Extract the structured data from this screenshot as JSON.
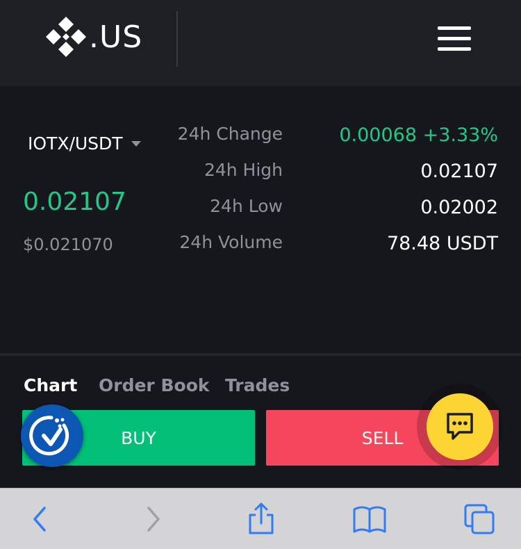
{
  "header": {
    "logo_text": ".US",
    "menu_icon": "hamburger-menu-icon"
  },
  "ticker": {
    "pair": "IOTX/USDT",
    "last_price": "0.02107",
    "usd_price": "$0.021070",
    "stats": [
      {
        "label": "24h Change",
        "value": "0.00068 +3.33%"
      },
      {
        "label": "24h High",
        "value": "0.02107"
      },
      {
        "label": "24h Low",
        "value": "0.02002"
      },
      {
        "label": "24h Volume",
        "value": "78.48 USDT"
      }
    ]
  },
  "tabs": [
    "Chart",
    "Order Book",
    "Trades"
  ],
  "actions": {
    "buy_label": "BUY",
    "sell_label": "SELL"
  },
  "floating": {
    "cookie_icon": "cookie-consent-icon",
    "chat_icon": "chat-icon"
  },
  "browser_toolbar": {
    "icons": [
      "back-icon",
      "forward-icon",
      "share-icon",
      "bookmarks-icon",
      "tabs-icon"
    ]
  },
  "colors": {
    "positive": "#20c986",
    "buy": "#02c077",
    "sell": "#f6465d",
    "accent_yellow": "#fcd535",
    "cookie_blue": "#0d57b4",
    "safari_blue": "#2f7cf6"
  }
}
